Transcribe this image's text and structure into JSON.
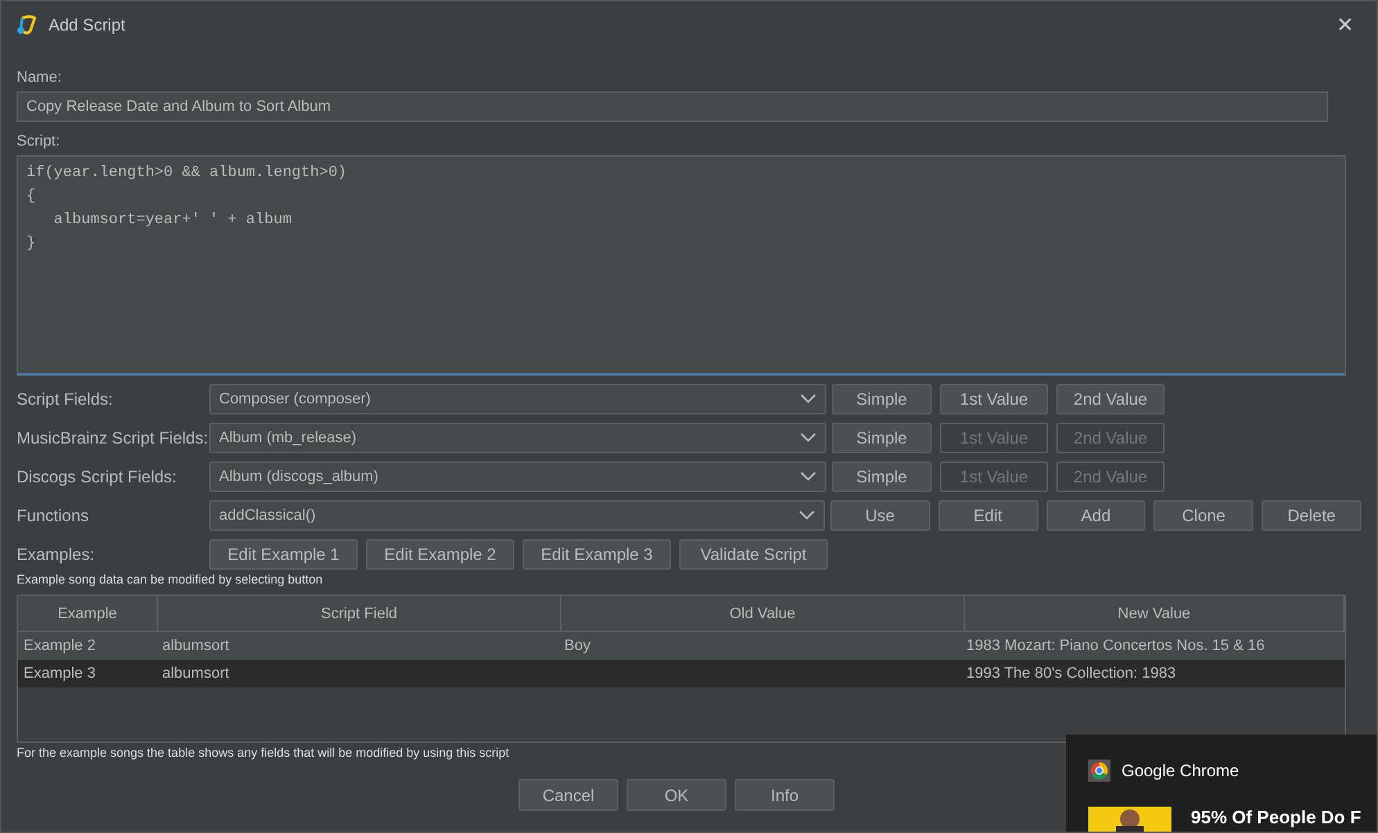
{
  "window": {
    "title": "Add Script",
    "close": "✕"
  },
  "name_label": "Name:",
  "name_value": "Copy Release Date and Album to Sort Album",
  "script_label": "Script:",
  "script_lines": [
    "if(year.length>0 && album.length>0)",
    "{",
    "   albumsort=year+' ' + album",
    "}"
  ],
  "field_rows": [
    {
      "label": "Script Fields:",
      "value": "Composer (composer)",
      "buttons": [
        {
          "label": "Simple",
          "disabled": false
        },
        {
          "label": "1st Value",
          "disabled": false
        },
        {
          "label": "2nd Value",
          "disabled": false
        }
      ]
    },
    {
      "label": "MusicBrainz Script Fields:",
      "value": "Album (mb_release)",
      "buttons": [
        {
          "label": "Simple",
          "disabled": false
        },
        {
          "label": "1st Value",
          "disabled": true
        },
        {
          "label": "2nd Value",
          "disabled": true
        }
      ]
    },
    {
      "label": "Discogs Script Fields:",
      "value": "Album (discogs_album)",
      "buttons": [
        {
          "label": "Simple",
          "disabled": false
        },
        {
          "label": "1st Value",
          "disabled": true
        },
        {
          "label": "2nd Value",
          "disabled": true
        }
      ]
    },
    {
      "label": "Functions",
      "value": "addClassical()",
      "buttons": [
        {
          "label": "Use",
          "disabled": false
        },
        {
          "label": "Edit",
          "disabled": false
        },
        {
          "label": "Add",
          "disabled": false
        },
        {
          "label": "Clone",
          "disabled": false
        },
        {
          "label": "Delete",
          "disabled": false
        }
      ]
    }
  ],
  "examples": {
    "label": "Examples:",
    "buttons": [
      "Edit Example 1",
      "Edit Example 2",
      "Edit Example 3",
      "Validate Script"
    ],
    "hint": "Example song data can be modified by selecting button"
  },
  "table": {
    "columns": [
      "Example",
      "Script Field",
      "Old Value",
      "New Value"
    ],
    "rows": [
      {
        "cells": [
          "Example 2",
          "albumsort",
          "Boy",
          "1983 Mozart: Piano Concertos Nos. 15 & 16"
        ],
        "selected": false
      },
      {
        "cells": [
          "Example 3",
          "albumsort",
          "",
          "1993 The 80's Collection: 1983"
        ],
        "selected": true
      }
    ]
  },
  "table_note": "For the example songs the table shows any fields that will be modified by using this script",
  "buttons": [
    "Cancel",
    "OK",
    "Info"
  ],
  "notification": {
    "app": "Google Chrome",
    "headline": "95% Of People Do F"
  }
}
